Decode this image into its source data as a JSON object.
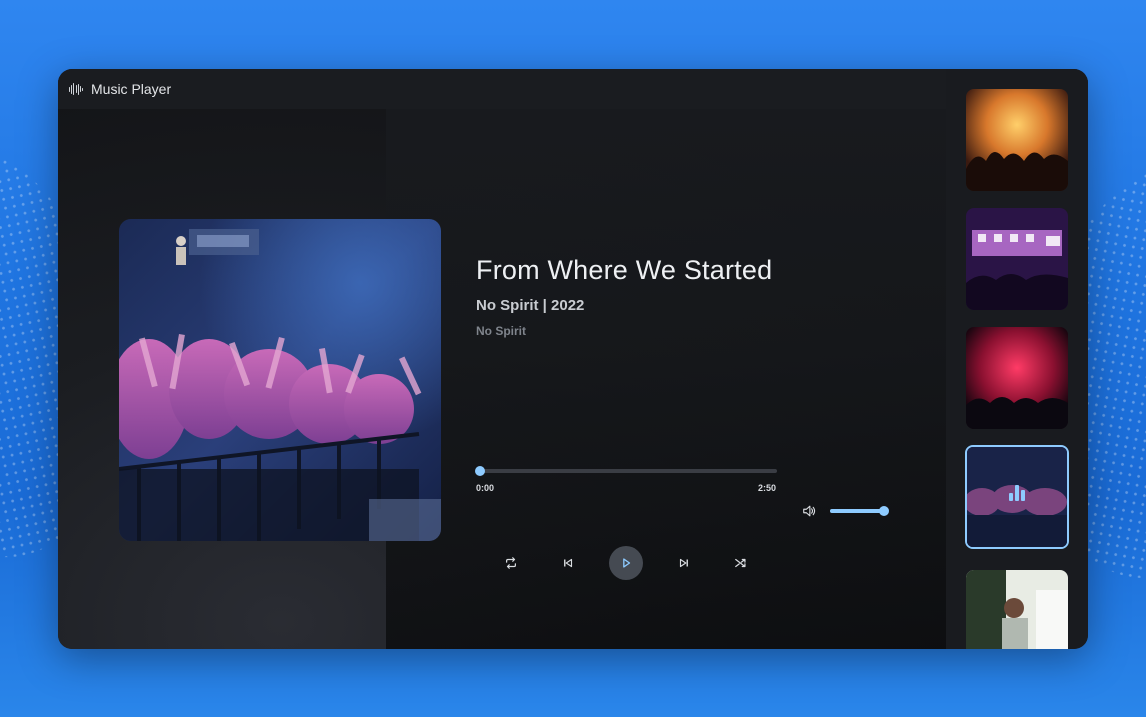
{
  "app": {
    "title": "Music Player",
    "icon": "waveform-icon"
  },
  "now_playing": {
    "title": "From Where We Started",
    "subtitle": "No Spirit | 2022",
    "artist": "No Spirit",
    "album_art": "concert crowd cover photo"
  },
  "progress": {
    "current": "0:00",
    "total": "2:50",
    "fraction": 0.0
  },
  "volume": {
    "icon": "volume-icon",
    "fraction": 1.0
  },
  "controls": {
    "repeat": "repeat-icon",
    "previous": "skip-previous-icon",
    "play": "play-icon",
    "next": "skip-next-icon",
    "shuffle": "shuffle-icon"
  },
  "playlist": {
    "items": [
      {
        "art": "concert-orange-lights"
      },
      {
        "art": "concert-purple-stage"
      },
      {
        "art": "concert-red-smoke"
      },
      {
        "art": "concert-crowd-blue",
        "active": true
      },
      {
        "art": "concert-performer-green"
      }
    ]
  },
  "colors": {
    "accent": "#8ecbff",
    "window_bg": "#191b1f",
    "page_bg": "#2a7fe8"
  }
}
